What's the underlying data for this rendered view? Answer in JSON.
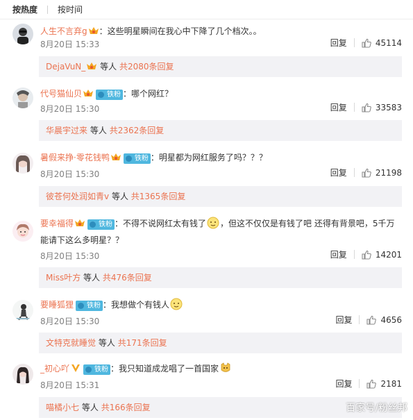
{
  "sort_tabs": [
    {
      "label": "按热度",
      "active": true
    },
    {
      "label": "按时间",
      "active": false
    }
  ],
  "comments": [
    {
      "username": "人生不言弃g",
      "badges": [
        "vip"
      ],
      "text": "：这些明星瞬间在我心中下降了几个档次。。",
      "date": "8月20日 15:33",
      "reply_label": "回复",
      "likes": "45114",
      "sub_reply": {
        "name": "DejaVuN_",
        "suffix": "等人",
        "count": "共2080条回复"
      }
    },
    {
      "username": "代号猫仙贝",
      "badges": [
        "vip",
        "fan"
      ],
      "fan_label": "铁粉",
      "text": "：哪个网红？",
      "date": "8月20日 15:30",
      "reply_label": "回复",
      "likes": "33583",
      "sub_reply": {
        "name": "华晨宇过来",
        "suffix": "等人",
        "count": "共2362条回复"
      }
    },
    {
      "username": "暑假来挣·零花钱鸭",
      "badges": [
        "vip",
        "fan"
      ],
      "fan_label": "铁粉",
      "text": "：明星都为网红服务了吗？？？",
      "date": "8月20日 15:30",
      "reply_label": "回复",
      "likes": "21198",
      "sub_reply": {
        "name": "彼苍何处润如青v",
        "suffix": "等人",
        "count": "共1365条回复"
      }
    },
    {
      "username": "要幸福得",
      "badges": [
        "vip",
        "fan"
      ],
      "fan_label": "铁粉",
      "text_a": "：不得不说网红太有钱了",
      "text_b": "，但这不仅仅是有钱了吧 还得有背景吧，5千万能请下这么多明星？？",
      "date": "8月20日 15:30",
      "reply_label": "回复",
      "likes": "14201",
      "sub_reply": {
        "name": "Miss叶方",
        "suffix": "等人",
        "count": "共476条回复"
      }
    },
    {
      "username": "要睡狐狸",
      "badges": [
        "fan"
      ],
      "fan_label": "铁粉",
      "text": "：我想做个有钱人",
      "date": "8月20日 15:30",
      "reply_label": "回复",
      "likes": "4656",
      "sub_reply": {
        "name": "文特克就睡觉",
        "suffix": "等人",
        "count": "共171条回复"
      }
    },
    {
      "username": "_初心吖",
      "badges": [
        "v",
        "fan"
      ],
      "fan_label": "铁粉",
      "text": "：我只知道成龙唱了一首国家",
      "date": "8月20日 15:31",
      "reply_label": "回复",
      "likes": "2181",
      "sub_reply": {
        "name": "喵橘小七",
        "suffix": "等人",
        "count": "共166条回复"
      }
    }
  ],
  "watermark": "百家号/粉丝邦",
  "colors": {
    "username": "#eb7350",
    "fan_badge": "#4fb7df",
    "reply_bg": "#f2f2f5"
  },
  "icons": [
    "vip-crown-icon",
    "fan-badge-icon",
    "thumbs-up-icon",
    "emoji-icon"
  ]
}
